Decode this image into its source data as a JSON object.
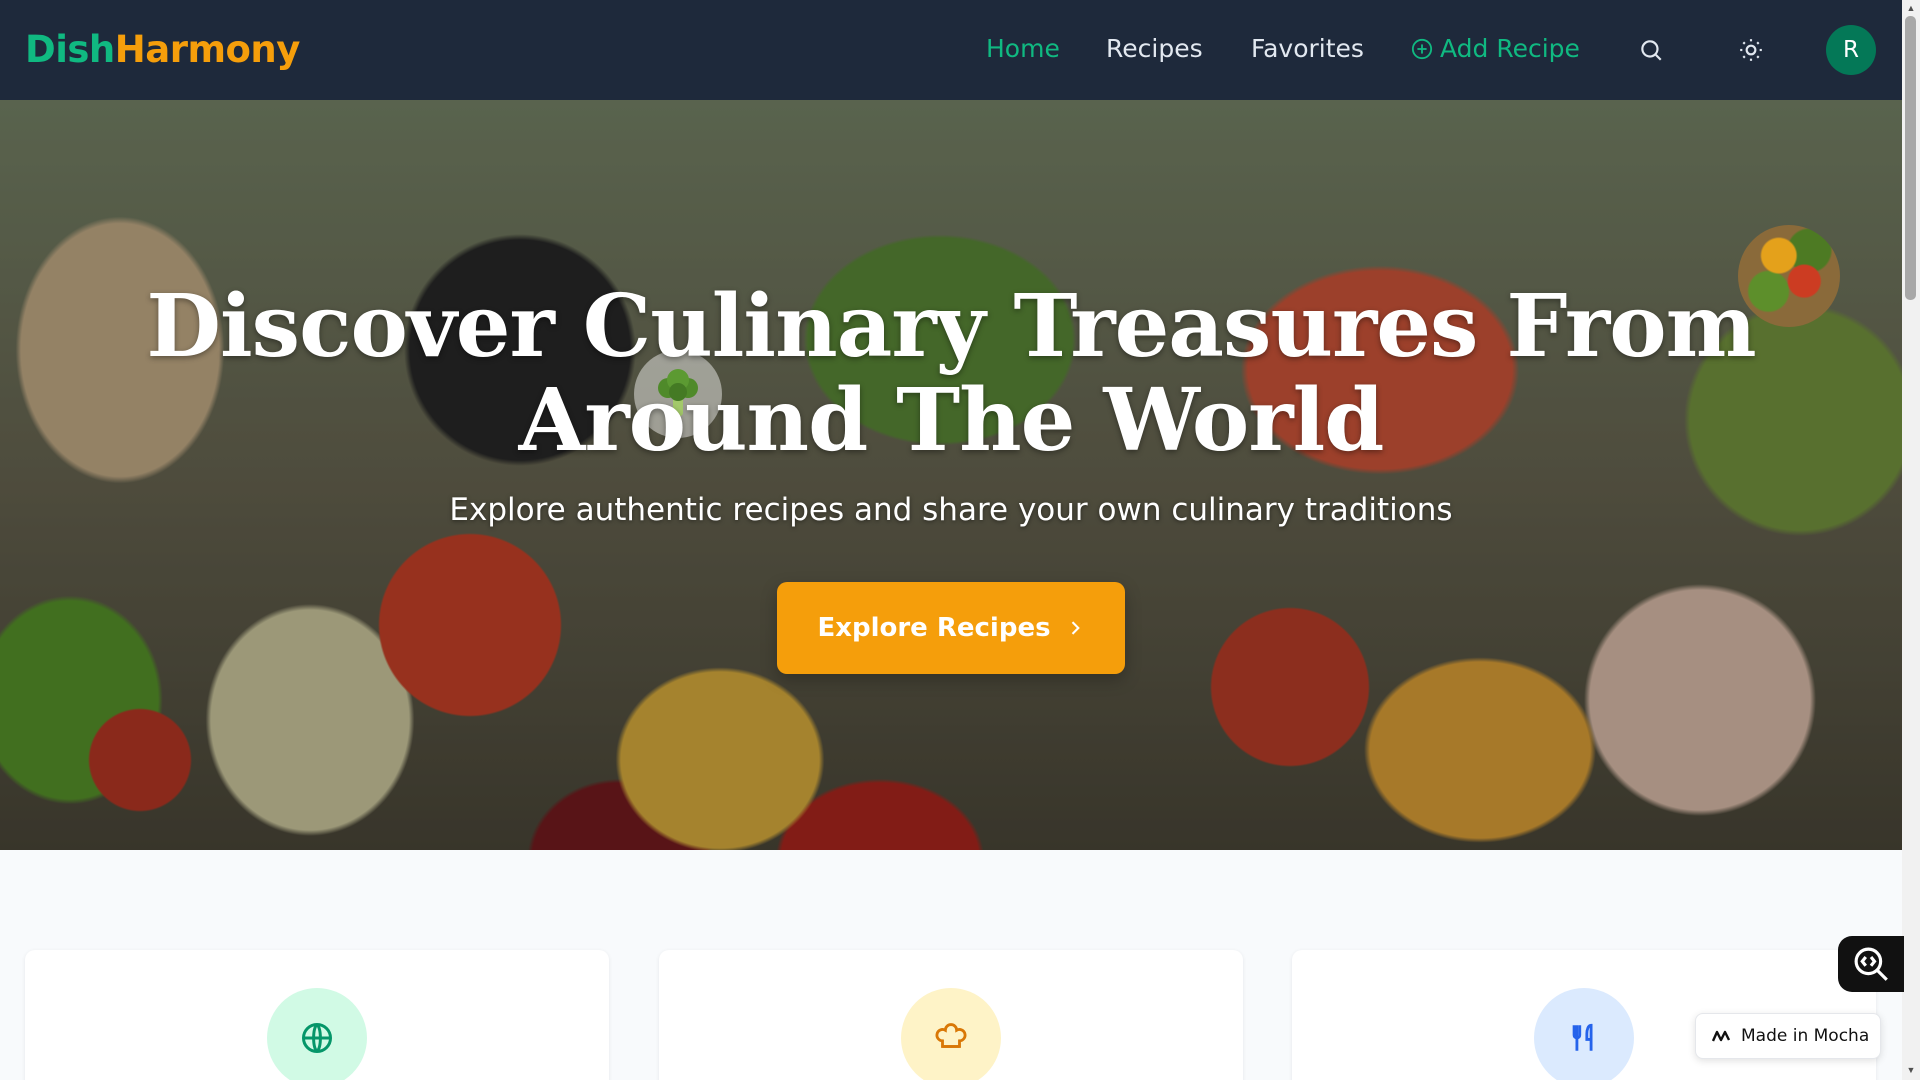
{
  "brand": {
    "part1": "Dish",
    "part2": "Harmony"
  },
  "nav": {
    "home": "Home",
    "recipes": "Recipes",
    "favorites": "Favorites",
    "add_recipe": "Add Recipe",
    "avatar_initial": "R"
  },
  "hero": {
    "title": "Discover Culinary Treasures From Around The World",
    "subtitle": "Explore authentic recipes and share your own culinary traditions",
    "cta": "Explore Recipes"
  },
  "features": [
    {
      "icon": "globe-icon",
      "bg": "#d1fae5",
      "color": "#059669"
    },
    {
      "icon": "chef-hat-icon",
      "bg": "#fef3c7",
      "color": "#d97706"
    },
    {
      "icon": "utensils-icon",
      "bg": "#dbeafe",
      "color": "#2563eb"
    }
  ],
  "mocha": {
    "badge": "Made in Mocha"
  },
  "colors": {
    "nav_bg": "#1e293b",
    "primary": "#10b981",
    "accent": "#f59e0b"
  }
}
